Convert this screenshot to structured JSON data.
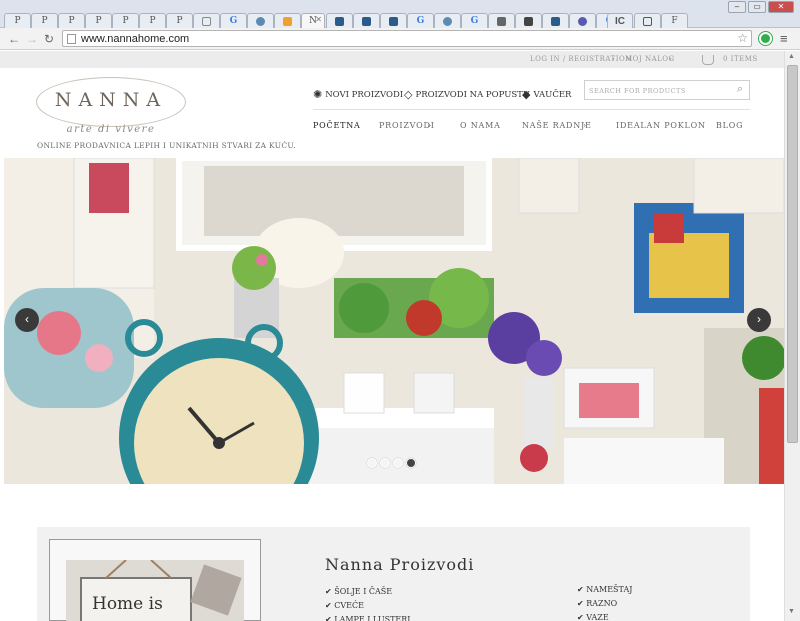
{
  "browser": {
    "tabs": [
      "P",
      "P",
      "P",
      "P",
      "P",
      "P",
      "P",
      "",
      "G",
      "",
      "",
      "N",
      "",
      "",
      "",
      "G",
      "",
      "G",
      "",
      "",
      "",
      "G",
      "IC",
      "",
      "F"
    ],
    "url": "www.nannahome.com"
  },
  "topbar": {
    "login": "LOG IN / REGISTRATION",
    "account": "MOJ NALOG",
    "cart": "0 ITEMS"
  },
  "logo": {
    "name": "NANNA",
    "subtitle": "arte di vivere",
    "tagline": "ONLINE PRODAVNICA LEPIH I UNIKATNIH STVARI ZA KUĆU."
  },
  "features": {
    "new": "NOVI PROIZVODI",
    "sale": "PROIZVODI NA POPUSTU",
    "voucher": "VAUČER"
  },
  "search": {
    "placeholder": "SEARCH FOR PRODUCTS"
  },
  "nav": {
    "home": "POČETNA",
    "products": "PROIZVODI",
    "about": "O NAMA",
    "shops": "NAŠE RADNJE",
    "gift": "IDEALAN POKLON",
    "blog": "BLOG"
  },
  "slider": {
    "dots": 4,
    "active_dot": 4
  },
  "products": {
    "title": "Nanna Proizvodi",
    "image_text": "Home is",
    "col1": [
      "ŠOLJE I ČAŠE",
      "CVEĆE",
      "LAMPE I LUSTERI"
    ],
    "col2": [
      "NAMEŠTAJ",
      "RAZNO",
      "VAZE"
    ]
  }
}
